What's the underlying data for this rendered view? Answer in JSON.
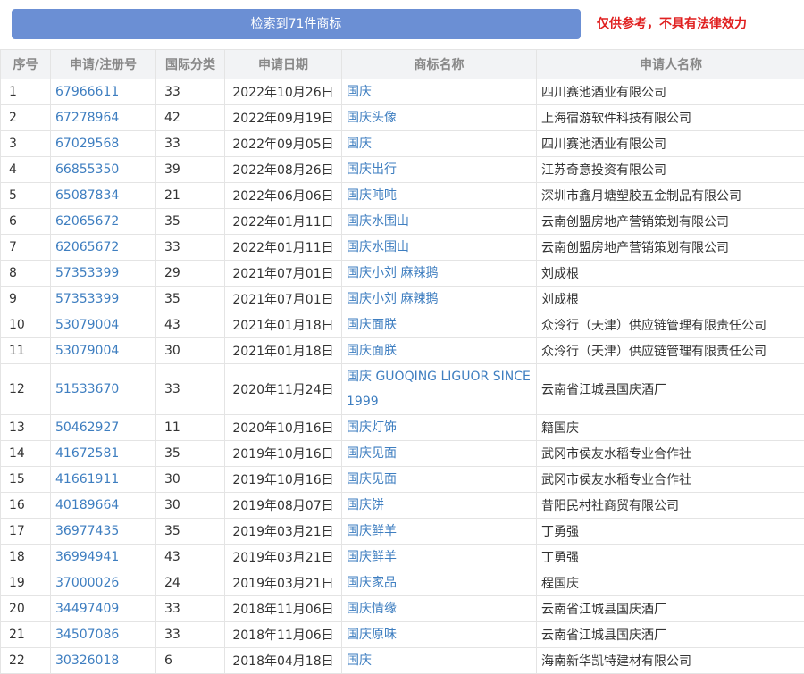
{
  "header": {
    "result_label": "检索到71件商标",
    "disclaimer": "仅供参考，不具有法律效力"
  },
  "table": {
    "columns": [
      "序号",
      "申请/注册号",
      "国际分类",
      "申请日期",
      "商标名称",
      "申请人名称"
    ],
    "rows": [
      {
        "no": "1",
        "reg": "67966611",
        "cls": "33",
        "date": "2022年10月26日",
        "name": "国庆",
        "applicant": "四川赛池酒业有限公司"
      },
      {
        "no": "2",
        "reg": "67278964",
        "cls": "42",
        "date": "2022年09月19日",
        "name": "国庆头像",
        "applicant": "上海宿游软件科技有限公司"
      },
      {
        "no": "3",
        "reg": "67029568",
        "cls": "33",
        "date": "2022年09月05日",
        "name": "国庆",
        "applicant": "四川赛池酒业有限公司"
      },
      {
        "no": "4",
        "reg": "66855350",
        "cls": "39",
        "date": "2022年08月26日",
        "name": "国庆出行",
        "applicant": "江苏奇意投资有限公司"
      },
      {
        "no": "5",
        "reg": "65087834",
        "cls": "21",
        "date": "2022年06月06日",
        "name": "国庆吨吨",
        "applicant": "深圳市鑫月塘塑胶五金制品有限公司"
      },
      {
        "no": "6",
        "reg": "62065672",
        "cls": "35",
        "date": "2022年01月11日",
        "name": "国庆水围山",
        "applicant": "云南创盟房地产营销策划有限公司"
      },
      {
        "no": "7",
        "reg": "62065672",
        "cls": "33",
        "date": "2022年01月11日",
        "name": "国庆水围山",
        "applicant": "云南创盟房地产营销策划有限公司"
      },
      {
        "no": "8",
        "reg": "57353399",
        "cls": "29",
        "date": "2021年07月01日",
        "name": "国庆小刘 麻辣鹅",
        "applicant": "刘成根"
      },
      {
        "no": "9",
        "reg": "57353399",
        "cls": "35",
        "date": "2021年07月01日",
        "name": "国庆小刘 麻辣鹅",
        "applicant": "刘成根"
      },
      {
        "no": "10",
        "reg": "53079004",
        "cls": "43",
        "date": "2021年01月18日",
        "name": "国庆面朕",
        "applicant": "众泠行（天津）供应链管理有限责任公司"
      },
      {
        "no": "11",
        "reg": "53079004",
        "cls": "30",
        "date": "2021年01月18日",
        "name": "国庆面朕",
        "applicant": "众泠行（天津）供应链管理有限责任公司"
      },
      {
        "no": "12",
        "reg": "51533670",
        "cls": "33",
        "date": "2020年11月24日",
        "name": "国庆 GUOQING LIGUOR SINCE 1999",
        "applicant": "云南省江城县国庆酒厂"
      },
      {
        "no": "13",
        "reg": "50462927",
        "cls": "11",
        "date": "2020年10月16日",
        "name": "国庆灯饰",
        "applicant": "籍国庆"
      },
      {
        "no": "14",
        "reg": "41672581",
        "cls": "35",
        "date": "2019年10月16日",
        "name": "国庆见面",
        "applicant": "武冈市侯友水稻专业合作社"
      },
      {
        "no": "15",
        "reg": "41661911",
        "cls": "30",
        "date": "2019年10月16日",
        "name": "国庆见面",
        "applicant": "武冈市侯友水稻专业合作社"
      },
      {
        "no": "16",
        "reg": "40189664",
        "cls": "30",
        "date": "2019年08月07日",
        "name": "国庆饼",
        "applicant": "昔阳民村社商贸有限公司"
      },
      {
        "no": "17",
        "reg": "36977435",
        "cls": "35",
        "date": "2019年03月21日",
        "name": "国庆鲜羊",
        "applicant": "丁勇强"
      },
      {
        "no": "18",
        "reg": "36994941",
        "cls": "43",
        "date": "2019年03月21日",
        "name": "国庆鲜羊",
        "applicant": "丁勇强"
      },
      {
        "no": "19",
        "reg": "37000026",
        "cls": "24",
        "date": "2019年03月21日",
        "name": "国庆家品",
        "applicant": "程国庆"
      },
      {
        "no": "20",
        "reg": "34497409",
        "cls": "33",
        "date": "2018年11月06日",
        "name": "国庆情缘",
        "applicant": "云南省江城县国庆酒厂"
      },
      {
        "no": "21",
        "reg": "34507086",
        "cls": "33",
        "date": "2018年11月06日",
        "name": "国庆原味",
        "applicant": "云南省江城县国庆酒厂"
      },
      {
        "no": "22",
        "reg": "30326018",
        "cls": "6",
        "date": "2018年04月18日",
        "name": "国庆",
        "applicant": "海南新华凯特建材有限公司"
      }
    ]
  },
  "colors": {
    "button_bg": "#6b8fd4",
    "disclaimer": "#e02020",
    "link": "#3e7ec0",
    "header_bg": "#f2f3f5",
    "border": "#e4e4e4"
  }
}
